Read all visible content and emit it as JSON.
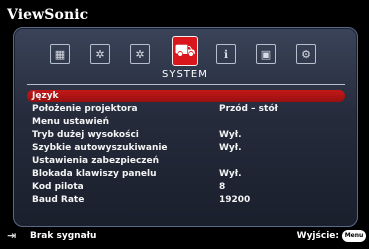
{
  "brand": "ViewSonic",
  "tabs": [
    {
      "icon": "picture-adjust-icon",
      "glyph": "▦",
      "active": false
    },
    {
      "icon": "settings-cog-icon",
      "glyph": "✲",
      "active": false
    },
    {
      "icon": "advanced-gear-icon",
      "glyph": "✲",
      "active": false
    },
    {
      "icon": "system-tools-icon",
      "glyph": "⛟",
      "active": true
    },
    {
      "icon": "information-icon",
      "glyph": "ℹ",
      "active": false
    },
    {
      "icon": "display-screen-icon",
      "glyph": "▣",
      "active": false
    },
    {
      "icon": "extra-options-icon",
      "glyph": "⚙",
      "active": false
    }
  ],
  "active_tab_label": "SYSTEM",
  "menu": [
    {
      "label": "Język",
      "value": "",
      "selected": true
    },
    {
      "label": "Położenie projektora",
      "value": "Przód – stół",
      "selected": false
    },
    {
      "label": "Menu ustawień",
      "value": "",
      "selected": false
    },
    {
      "label": "Tryb dużej wysokości",
      "value": "Wył.",
      "selected": false
    },
    {
      "label": "Szybkie autowyszukiwanie",
      "value": "Wył.",
      "selected": false
    },
    {
      "label": "Ustawienia zabezpieczeń",
      "value": "",
      "selected": false
    },
    {
      "label": "Blokada klawiszy panelu",
      "value": "Wył.",
      "selected": false
    },
    {
      "label": "Kod pilota",
      "value": "8",
      "selected": false
    },
    {
      "label": "Baud Rate",
      "value": "19200",
      "selected": false
    }
  ],
  "footer": {
    "status_icon": "input-source-icon",
    "status_text": "Brak sygnału",
    "exit_text": "Wyjście:",
    "menu_key": "Menu"
  }
}
